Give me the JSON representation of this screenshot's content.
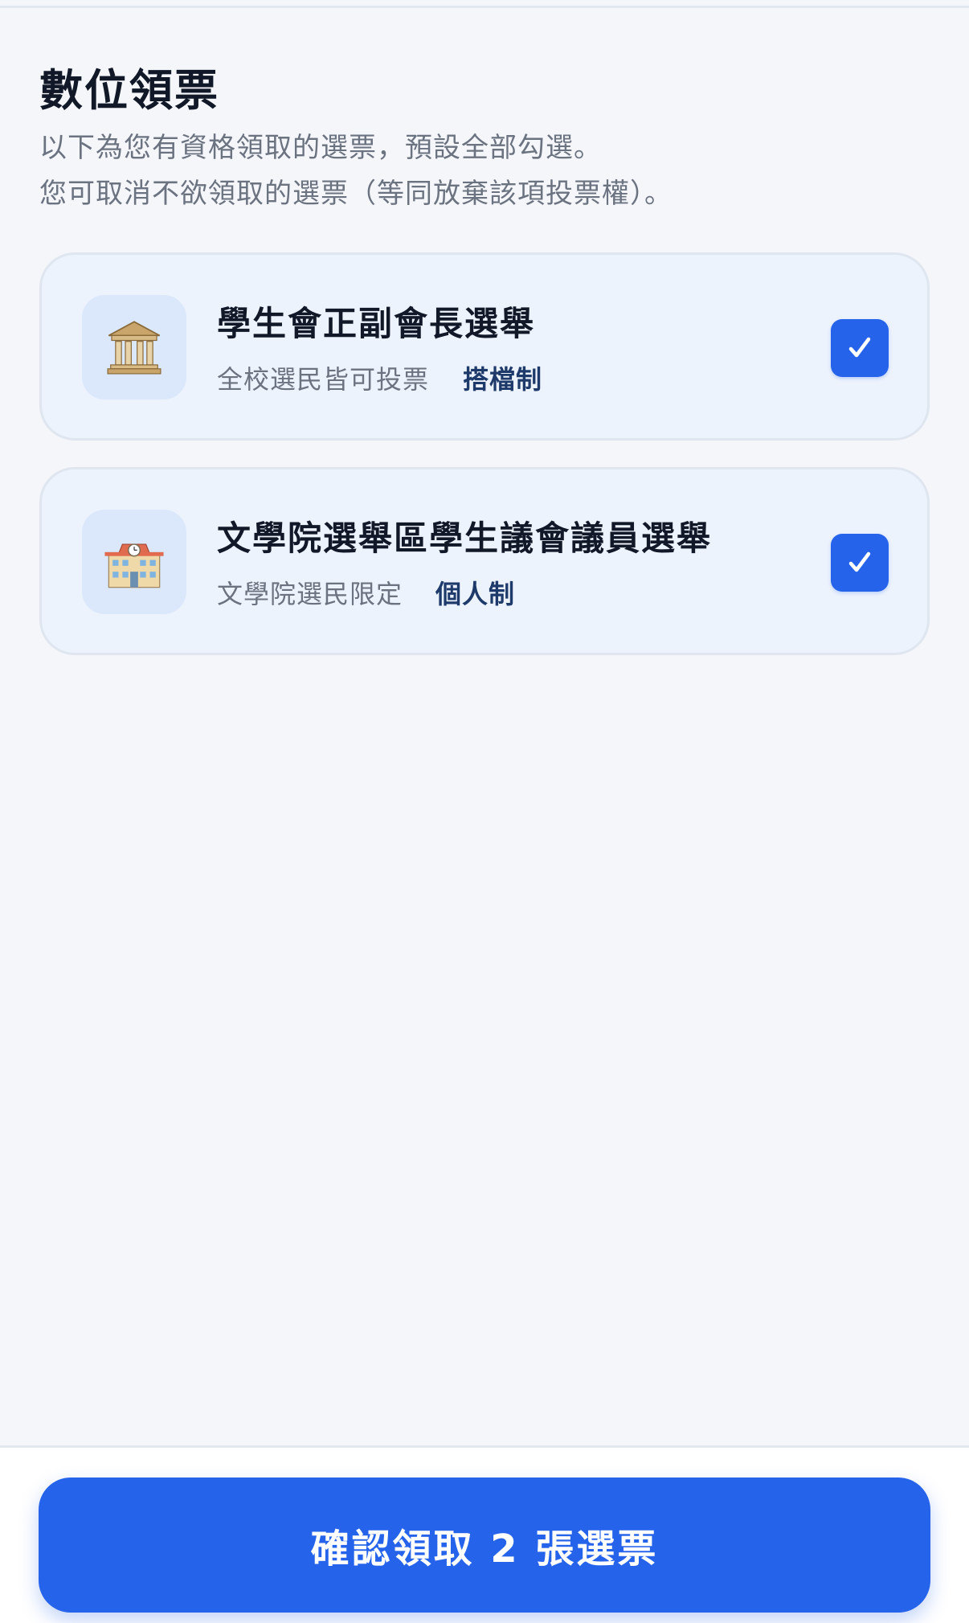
{
  "header": {
    "title": "數位領票",
    "subtitle_line1": "以下為您有資格領取的選票，預設全部勾選。",
    "subtitle_line2": "您可取消不欲領取的選票（等同放棄該項投票權）。"
  },
  "ballots": [
    {
      "icon": "classical-building-icon",
      "title": "學生會正副會長選舉",
      "eligibility": "全校選民皆可投票",
      "system": "搭檔制",
      "checked": true
    },
    {
      "icon": "school-building-icon",
      "title": "文學院選舉區學生議會議員選舉",
      "eligibility": "文學院選民限定",
      "system": "個人制",
      "checked": true
    }
  ],
  "footer": {
    "confirm_label": "確認領取 2 張選票"
  },
  "colors": {
    "accent": "#2563eb",
    "card_bg": "#edf3fd",
    "page_bg": "#f4f6fa",
    "system_text": "#1e3a6b"
  }
}
